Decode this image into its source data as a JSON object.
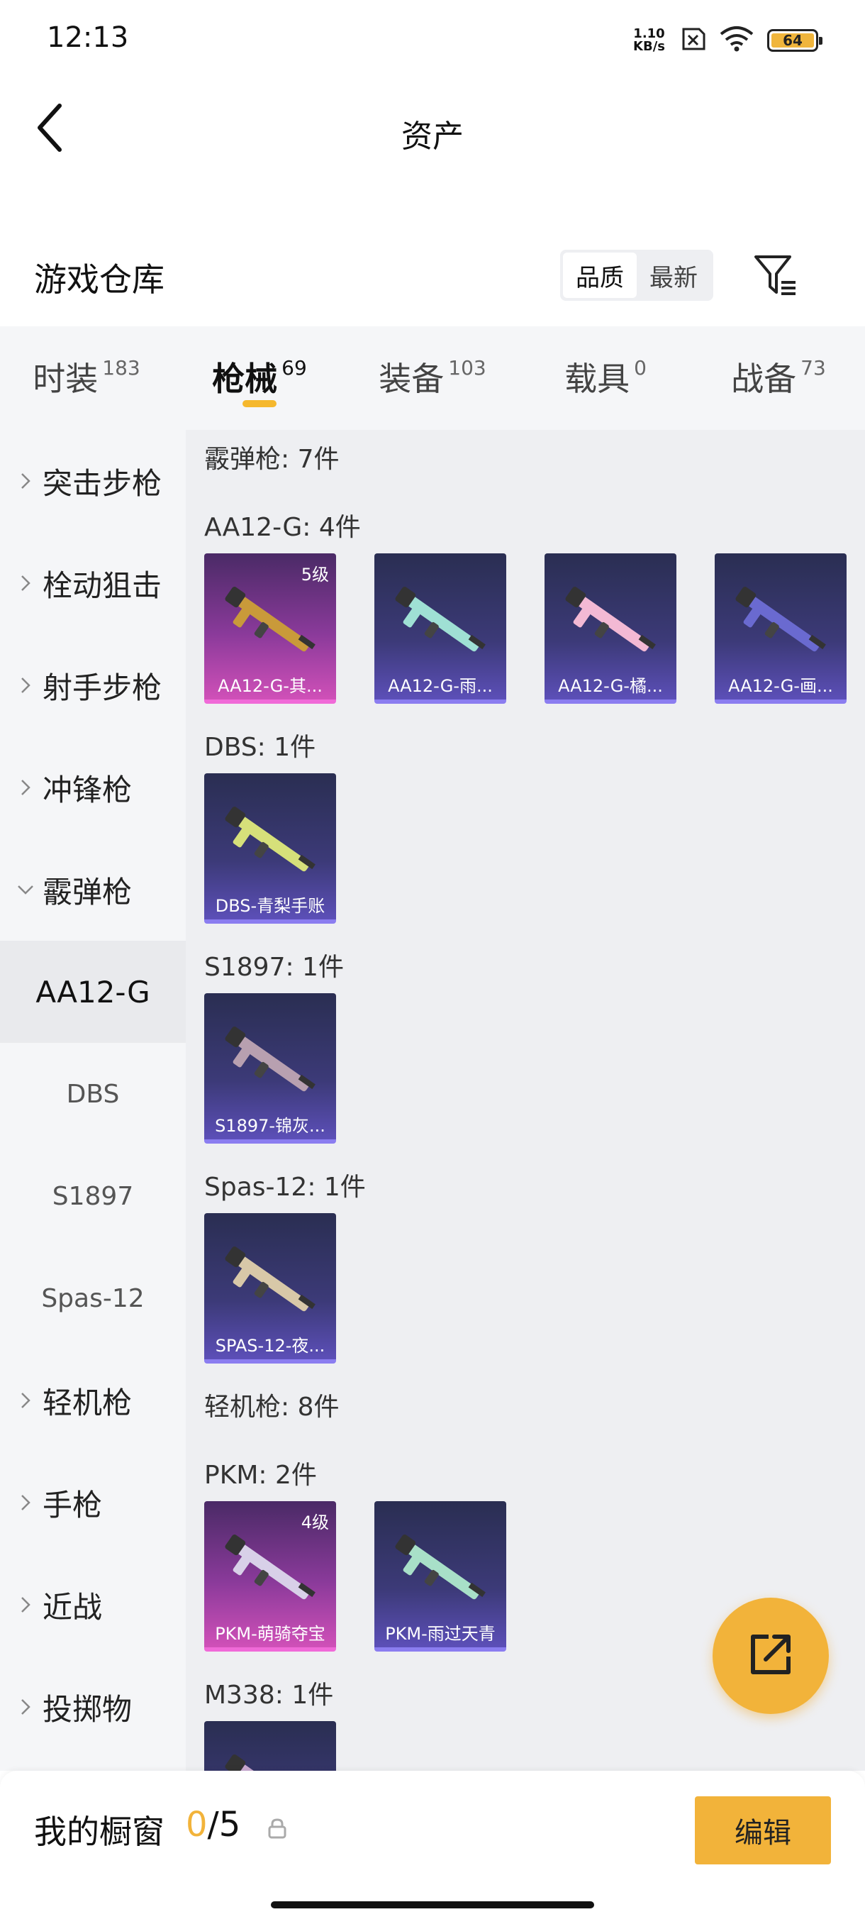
{
  "status": {
    "time": "12:13",
    "net_speed_value": "1.10",
    "net_speed_unit": "KB/s",
    "battery": "64"
  },
  "header": {
    "title": "资产"
  },
  "warehouse": {
    "title": "游戏仓库",
    "sort_options": [
      "品质",
      "最新"
    ],
    "active_sort": "品质"
  },
  "tabs": [
    {
      "label": "时装",
      "count": "183"
    },
    {
      "label": "枪械",
      "count": "69"
    },
    {
      "label": "装备",
      "count": "103"
    },
    {
      "label": "载具",
      "count": "0"
    },
    {
      "label": "战备",
      "count": "73"
    }
  ],
  "sidebar": {
    "items": [
      "突击步枪",
      "栓动狙击",
      "射手步枪",
      "冲锋枪",
      "霰弹枪"
    ],
    "subitems": [
      "AA12-G",
      "DBS",
      "S1897",
      "Spas-12"
    ],
    "items_after": [
      "轻机枪",
      "手枪",
      "近战",
      "投掷物"
    ]
  },
  "content": {
    "groups": [
      {
        "label": "霰弹枪: 7件"
      },
      {
        "label": "AA12-G: 4件"
      },
      {
        "label": "DBS: 1件"
      },
      {
        "label": "S1897: 1件"
      },
      {
        "label": "Spas-12: 1件"
      },
      {
        "label": "轻机枪: 8件"
      },
      {
        "label": "PKM: 2件"
      },
      {
        "label": "M338: 1件"
      }
    ],
    "cards": [
      {
        "name": "AA12-G-其...",
        "level": "5级",
        "rarity": "pink",
        "color": "#c99a3a"
      },
      {
        "name": "AA12-G-雨...",
        "level": "",
        "rarity": "purple",
        "color": "#9fe0d4"
      },
      {
        "name": "AA12-G-橘...",
        "level": "",
        "rarity": "purple",
        "color": "#f3b9d4"
      },
      {
        "name": "AA12-G-画...",
        "level": "",
        "rarity": "purple",
        "color": "#6a6ad0"
      },
      {
        "name": "DBS-青梨手账",
        "level": "",
        "rarity": "purple",
        "color": "#d6e07a"
      },
      {
        "name": "S1897-锦灰...",
        "level": "",
        "rarity": "purple",
        "color": "#b8a0b0"
      },
      {
        "name": "SPAS-12-夜...",
        "level": "",
        "rarity": "purple",
        "color": "#d8c8a8"
      },
      {
        "name": "PKM-萌骑夺宝",
        "level": "4级",
        "rarity": "pink",
        "color": "#d8d0e8"
      },
      {
        "name": "PKM-雨过天青",
        "level": "",
        "rarity": "purple",
        "color": "#a8e0c8"
      },
      {
        "name": "",
        "level": "",
        "rarity": "purple",
        "color": "#c8a8d0"
      }
    ]
  },
  "bottom": {
    "title": "我的橱窗",
    "used": "0",
    "total": "/5",
    "edit_label": "编辑"
  }
}
